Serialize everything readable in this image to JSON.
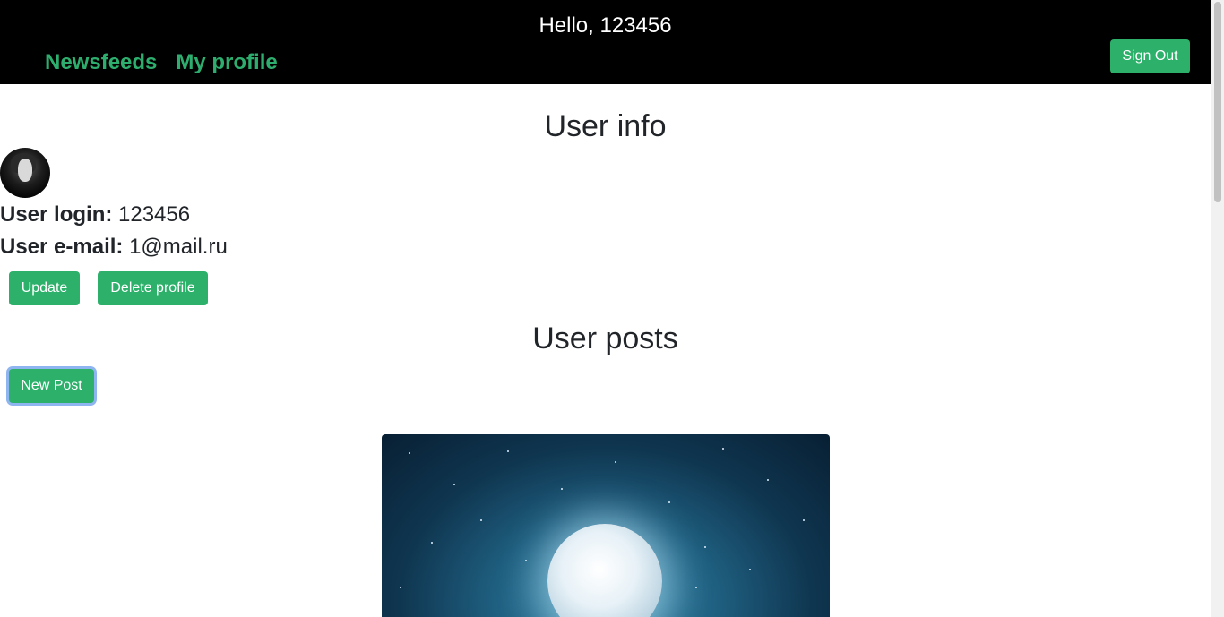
{
  "header": {
    "greeting": "Hello, 123456",
    "nav": [
      {
        "label": "Newsfeeds"
      },
      {
        "label": "My profile"
      }
    ],
    "sign_out_label": "Sign Out"
  },
  "user_info": {
    "title": "User info",
    "avatar_icon": "user-avatar-icon",
    "login_label": "User login:",
    "login_value": "123456",
    "email_label": "User e-mail:",
    "email_value": "1@mail.ru",
    "update_label": "Update",
    "delete_label": "Delete profile"
  },
  "user_posts": {
    "title": "User posts",
    "new_post_label": "New Post"
  },
  "colors": {
    "header_bg": "#000000",
    "accent": "#2cb06a",
    "nav_link": "#2eae6e",
    "focus_ring": "#8fb5f0"
  }
}
